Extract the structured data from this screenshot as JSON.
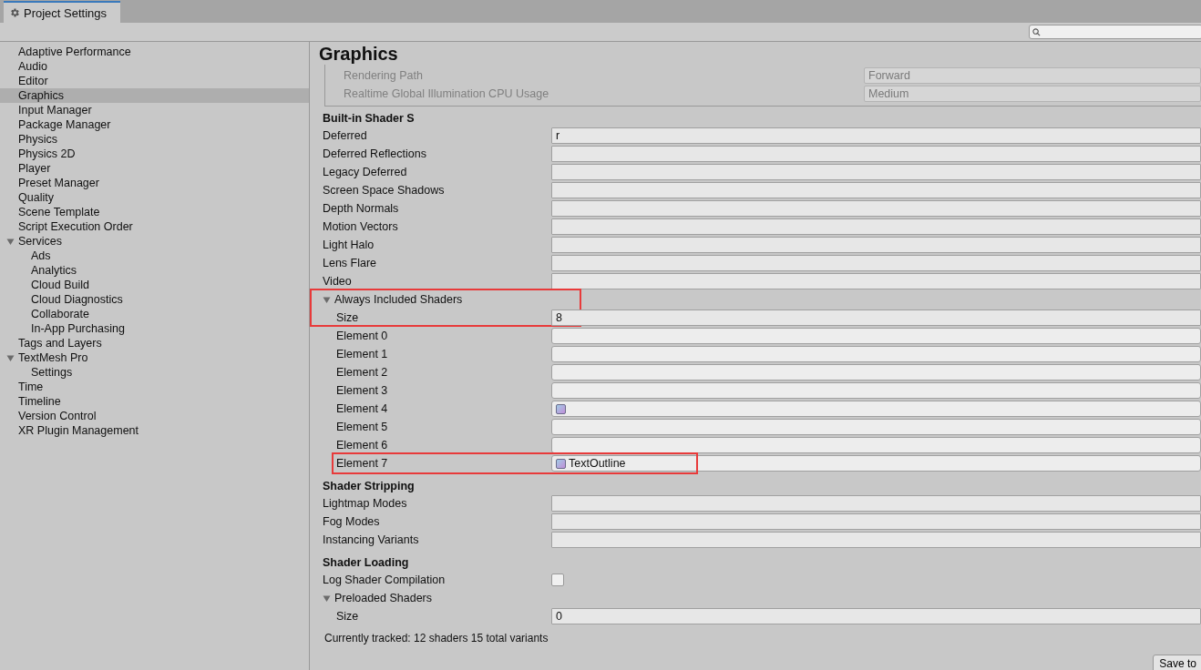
{
  "window": {
    "tab": "Project Settings"
  },
  "sidebar": {
    "items": [
      {
        "label": "Adaptive Performance",
        "selected": false
      },
      {
        "label": "Audio",
        "selected": false
      },
      {
        "label": "Editor",
        "selected": false
      },
      {
        "label": "Graphics",
        "selected": true
      },
      {
        "label": "Input Manager",
        "selected": false
      },
      {
        "label": "Package Manager",
        "selected": false
      },
      {
        "label": "Physics",
        "selected": false
      },
      {
        "label": "Physics 2D",
        "selected": false
      },
      {
        "label": "Player",
        "selected": false
      },
      {
        "label": "Preset Manager",
        "selected": false
      },
      {
        "label": "Quality",
        "selected": false
      },
      {
        "label": "Scene Template",
        "selected": false
      },
      {
        "label": "Script Execution Order",
        "selected": false
      },
      {
        "label": "Services",
        "selected": false,
        "expanded": true,
        "children": [
          {
            "label": "Ads",
            "selected": false
          },
          {
            "label": "Analytics",
            "selected": false
          },
          {
            "label": "Cloud Build",
            "selected": false
          },
          {
            "label": "Cloud Diagnostics",
            "selected": false
          },
          {
            "label": "Collaborate",
            "selected": false
          },
          {
            "label": "In-App Purchasing",
            "selected": false
          }
        ]
      },
      {
        "label": "Tags and Layers",
        "selected": false
      },
      {
        "label": "TextMesh Pro",
        "selected": false,
        "expanded": true,
        "children": [
          {
            "label": "Settings",
            "selected": false
          }
        ]
      },
      {
        "label": "Time",
        "selected": false
      },
      {
        "label": "Timeline",
        "selected": false
      },
      {
        "label": "Version Control",
        "selected": false
      },
      {
        "label": "XR Plugin Management",
        "selected": false
      }
    ]
  },
  "page": {
    "title": "Graphics",
    "tier_settings": [
      {
        "label": "Rendering Path",
        "value": "Forward",
        "disabled": true
      },
      {
        "label": "Realtime Global Illumination CPU Usage",
        "value": "Medium",
        "disabled": true
      }
    ],
    "sections": [
      {
        "title": "Built-in Shader S",
        "rows": [
          {
            "kind": "field",
            "label": "Deferred",
            "value": "r"
          },
          {
            "kind": "field",
            "label": "Deferred Reflections"
          },
          {
            "kind": "field",
            "label": "Legacy Deferred"
          },
          {
            "kind": "field",
            "label": "Screen Space Shadows"
          },
          {
            "kind": "field",
            "label": "Depth Normals"
          },
          {
            "kind": "field",
            "label": "Motion Vectors"
          },
          {
            "kind": "field",
            "label": "Light Halo"
          },
          {
            "kind": "field",
            "label": "Lens Flare"
          },
          {
            "kind": "field",
            "label": "Video"
          },
          {
            "kind": "foldout",
            "label": "Always Included Shaders",
            "expanded": true,
            "highlighted": true,
            "children": [
              {
                "kind": "field",
                "label": "Size",
                "value": "8"
              },
              {
                "kind": "object",
                "label": "Element 0"
              },
              {
                "kind": "object",
                "label": "Element 1"
              },
              {
                "kind": "object",
                "label": "Element 2"
              },
              {
                "kind": "object",
                "label": "Element 3"
              },
              {
                "kind": "object",
                "label": "Element 4",
                "icon": true
              },
              {
                "kind": "object",
                "label": "Element 5"
              },
              {
                "kind": "object",
                "label": "Element 6"
              },
              {
                "kind": "object",
                "label": "Element 7",
                "icon": true,
                "value": "TextOutline",
                "highlighted": true
              }
            ]
          }
        ]
      },
      {
        "title": "Shader Stripping",
        "rows": [
          {
            "kind": "field",
            "label": "Lightmap Modes"
          },
          {
            "kind": "field",
            "label": "Fog Modes"
          },
          {
            "kind": "field",
            "label": "Instancing Variants"
          }
        ]
      },
      {
        "title": "Shader Loading",
        "rows": [
          {
            "kind": "checkbox",
            "label": "Log Shader Compilation",
            "checked": false
          },
          {
            "kind": "foldout",
            "label": "Preloaded Shaders",
            "expanded": true,
            "highlighted": false,
            "children": [
              {
                "kind": "field",
                "label": "Size",
                "value": "0"
              }
            ]
          }
        ]
      }
    ],
    "status": "Currently tracked: 12 shaders 15 total variants"
  },
  "save_button": "Save to"
}
